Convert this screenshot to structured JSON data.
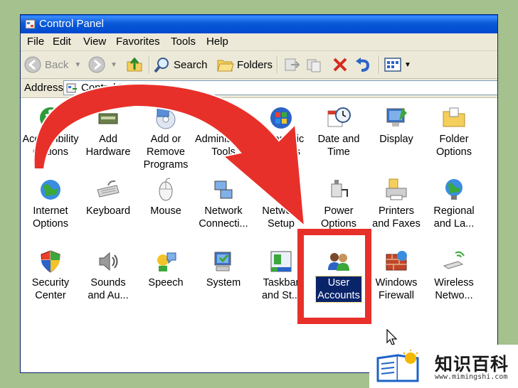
{
  "window": {
    "title": "Control Panel"
  },
  "menu": [
    "File",
    "Edit",
    "View",
    "Favorites",
    "Tools",
    "Help"
  ],
  "toolbar": {
    "back": "Back",
    "search": "Search",
    "folders": "Folders"
  },
  "address": {
    "label": "Address",
    "value": "Control Panel"
  },
  "items": [
    {
      "label": "Accessibility\nOptions",
      "icon": "accessibility-icon"
    },
    {
      "label": "Add\nHardware",
      "icon": "hardware-icon"
    },
    {
      "label": "Add or\nRemove Programs",
      "icon": "programs-icon"
    },
    {
      "label": "Administrative\nTools",
      "icon": "admin-tools-icon"
    },
    {
      "label": "Automatic\nUpdates",
      "icon": "windows-update-icon"
    },
    {
      "label": "Date and\nTime",
      "icon": "clock-icon"
    },
    {
      "label": "Display",
      "icon": "display-icon"
    },
    {
      "label": "Folder\nOptions",
      "icon": "folder-icon"
    },
    {
      "label": "Internet\nOptions",
      "icon": "globe-icon"
    },
    {
      "label": "Keyboard",
      "icon": "keyboard-icon"
    },
    {
      "label": "Mouse",
      "icon": "mouse-icon"
    },
    {
      "label": "Network\nConnecti...",
      "icon": "network-icon"
    },
    {
      "label": "Network\nSetup",
      "icon": "network-setup-icon"
    },
    {
      "label": "Power\nOptions",
      "icon": "power-icon"
    },
    {
      "label": "Printers\nand Faxes",
      "icon": "printer-icon"
    },
    {
      "label": "Regional\nand La...",
      "icon": "regional-icon"
    },
    {
      "label": "Security\nCenter",
      "icon": "shield-icon"
    },
    {
      "label": "Sounds\nand Au...",
      "icon": "speaker-icon"
    },
    {
      "label": "Speech",
      "icon": "speech-icon"
    },
    {
      "label": "System",
      "icon": "system-icon"
    },
    {
      "label": "Taskbar\nand St...",
      "icon": "taskbar-icon"
    },
    {
      "label": "User\nAccounts",
      "icon": "user-accounts-icon"
    },
    {
      "label": "Windows\nFirewall",
      "icon": "firewall-icon"
    },
    {
      "label": "Wireless\nNetwo...",
      "icon": "wireless-icon"
    }
  ],
  "brand": {
    "name": "知识百科",
    "url": "www.mimingshi.com"
  },
  "colors": {
    "annotation_red": "#e8302a",
    "selection": "#0a246a",
    "titlebar": "#0a5ad7"
  }
}
